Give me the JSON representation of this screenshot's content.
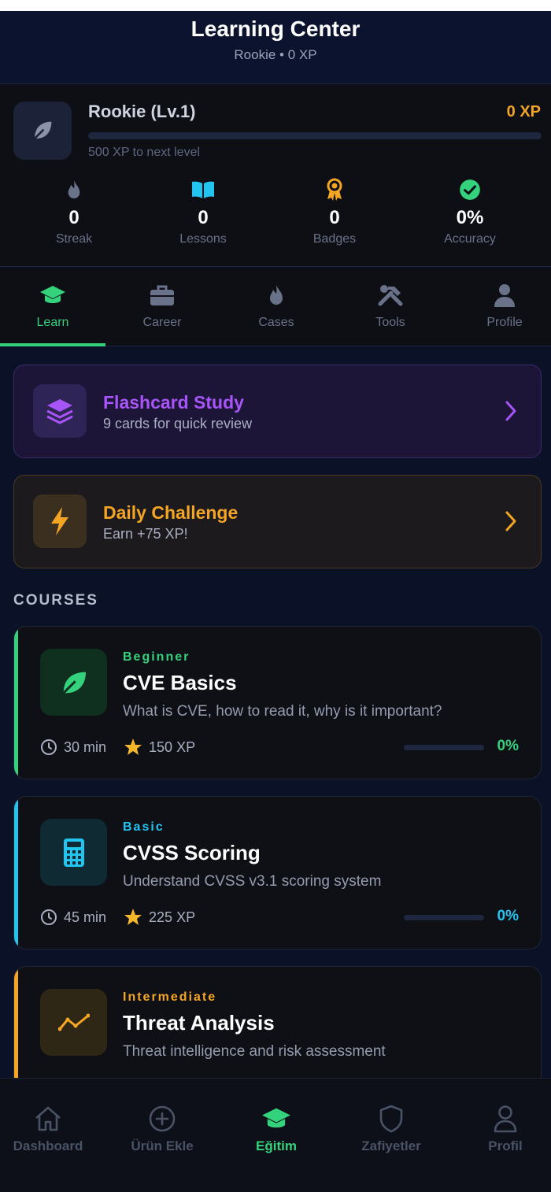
{
  "header": {
    "title": "Learning Center",
    "subtitle": "Rookie • 0 XP"
  },
  "profile": {
    "level_title": "Rookie (Lv.1)",
    "xp": "0 XP",
    "xp_progress_fraction": 0.0,
    "next_level_text": "500 XP to next level",
    "avatar_icon": "leaf-icon"
  },
  "stats": [
    {
      "icon": "flame-icon",
      "value": "0",
      "label": "Streak",
      "color": "#6a7289"
    },
    {
      "icon": "book-icon",
      "value": "0",
      "label": "Lessons",
      "color": "#22c4f0"
    },
    {
      "icon": "award-icon",
      "value": "0",
      "label": "Badges",
      "color": "#f5a524"
    },
    {
      "icon": "check-circle-icon",
      "value": "0%",
      "label": "Accuracy",
      "color": "#34d27c"
    }
  ],
  "tabs": [
    {
      "label": "Learn",
      "icon": "graduation-cap-icon",
      "active": true
    },
    {
      "label": "Career",
      "icon": "briefcase-icon",
      "active": false
    },
    {
      "label": "Cases",
      "icon": "flame-icon",
      "active": false
    },
    {
      "label": "Tools",
      "icon": "tools-icon",
      "active": false
    },
    {
      "label": "Profile",
      "icon": "user-icon",
      "active": false
    }
  ],
  "promos": {
    "flashcard": {
      "title": "Flashcard Study",
      "subtitle": "9 cards for quick review",
      "icon": "layers-icon"
    },
    "daily": {
      "title": "Daily Challenge",
      "subtitle": "Earn +75 XP!",
      "icon": "lightning-icon"
    }
  },
  "courses_title": "COURSES",
  "courses": [
    {
      "level": "Beginner",
      "title": "CVE Basics",
      "description": "What is CVE, how to read it, why is it important?",
      "duration": "30 min",
      "xp": "150 XP",
      "progress": "0%",
      "progress_fraction": 0.0,
      "color": "#34d27c",
      "icon": "leaf-icon"
    },
    {
      "level": "Basic",
      "title": "CVSS Scoring",
      "description": "Understand CVSS v3.1 scoring system",
      "duration": "45 min",
      "xp": "225 XP",
      "progress": "0%",
      "progress_fraction": 0.0,
      "color": "#22c4f0",
      "icon": "calculator-icon"
    },
    {
      "level": "Intermediate",
      "title": "Threat Analysis",
      "description": "Threat intelligence and risk assessment",
      "color": "#f5a524",
      "icon": "trend-line-icon"
    }
  ],
  "bottom_nav": [
    {
      "label": "Dashboard",
      "icon": "home-icon",
      "active": false
    },
    {
      "label": "Ürün Ekle",
      "icon": "plus-circle-icon",
      "active": false
    },
    {
      "label": "Eğitim",
      "icon": "graduation-cap-icon",
      "active": true
    },
    {
      "label": "Zafiyetler",
      "icon": "shield-icon",
      "active": false
    },
    {
      "label": "Profil",
      "icon": "user-icon",
      "active": false
    }
  ]
}
